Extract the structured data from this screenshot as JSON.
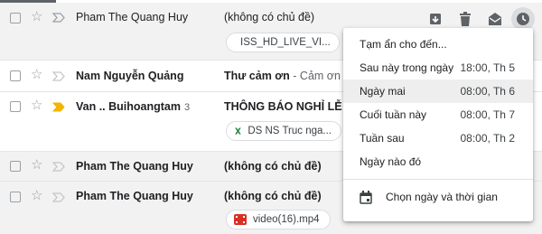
{
  "rows": [
    {
      "sender": "Pham The Quang Huy",
      "count": "",
      "subject": "(không có chủ đề)",
      "snippet": "",
      "attachment": "ISS_HD_LIVE_VI..."
    },
    {
      "sender": "Nam Nguyễn Quảng",
      "count": "",
      "subject": "Thư cảm ơn",
      "snippet": " - Cảm ơn bá",
      "attachment": ""
    },
    {
      "sender": "Van .. Buihoangtam",
      "count": "3",
      "subject": "THÔNG BÁO NGHỈ LỄ",
      "snippet": " - T",
      "attachment": "DS NS Truc nga..."
    },
    {
      "sender": "Pham The Quang Huy",
      "count": "",
      "subject": "(không có chủ đề)",
      "snippet": "",
      "attachment": ""
    },
    {
      "sender": "Pham The Quang Huy",
      "count": "",
      "subject": "(không có chủ đề)",
      "snippet": "",
      "attachment": "video(16).mp4"
    }
  ],
  "snooze_menu": {
    "title": "Tạm ẩn cho đến...",
    "items": [
      {
        "label": "Sau này trong ngày",
        "time": "18:00, Th 5"
      },
      {
        "label": "Ngày mai",
        "time": "08:00, Th 6"
      },
      {
        "label": "Cuối tuần này",
        "time": "08:00, Th 7"
      },
      {
        "label": "Tuần sau",
        "time": "08:00, Th 2"
      },
      {
        "label": "Ngày nào đó",
        "time": ""
      }
    ],
    "pick": "Chọn ngày và thời gian"
  },
  "colors": {
    "accent_yellow": "#f4b400",
    "file_red": "#d93025",
    "sheet_green": "#188038"
  },
  "icons": [
    "checkbox",
    "star-icon",
    "important-marker-icon",
    "archive-icon",
    "delete-icon",
    "mark-read-icon",
    "snooze-clock-icon",
    "video-file-icon",
    "sheet-file-icon",
    "calendar-icon"
  ]
}
